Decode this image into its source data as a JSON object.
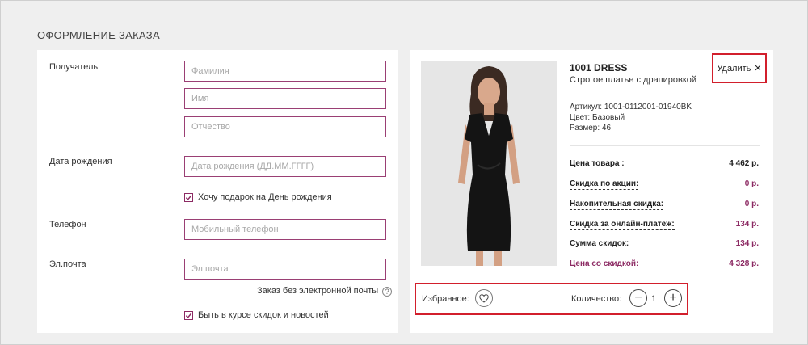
{
  "page": {
    "title": "ОФОРМЛЕНИЕ ЗАКАЗА"
  },
  "form": {
    "recipient_label": "Получатель",
    "last_name_placeholder": "Фамилия",
    "first_name_placeholder": "Имя",
    "middle_name_placeholder": "Отчество",
    "birthdate_label": "Дата рождения",
    "birthdate_placeholder": "Дата рождения (ДД.ММ.ГГГГ)",
    "birthday_gift_label": "Хочу подарок на День рождения",
    "birthday_gift_checked": true,
    "phone_label": "Телефон",
    "phone_placeholder": "Мобильный телефон",
    "email_label": "Эл.почта",
    "email_placeholder": "Эл.почта",
    "no_email_link": "Заказ без электронной почты",
    "help_glyph": "?",
    "newsletter_label": "Быть в курсе скидок и новостей",
    "newsletter_checked": true
  },
  "product": {
    "name": "1001 DRESS",
    "description": "Строгое платье с драпировкой",
    "remove_label": "Удалить",
    "remove_glyph": "✕",
    "article": "Артикул: 1001-0112001-01940BK",
    "color": "Цвет: Базовый",
    "size": "Размер: 46",
    "prices": [
      {
        "label": "Цена товара :",
        "value": "4 462 р."
      },
      {
        "label": "Скидка по акции:",
        "value": "0 р."
      },
      {
        "label": "Накопительная скидка:",
        "value": "0 р."
      },
      {
        "label": "Скидка за онлайн-платёж:",
        "value": "134 р."
      },
      {
        "label": "Сумма скидок:",
        "value": "134 р."
      },
      {
        "label": "Цена со скидкой:",
        "value": "4 328 р."
      }
    ],
    "favorite_label": "Избранное:",
    "quantity_label": "Количество:",
    "quantity": "1",
    "minus_glyph": "−",
    "plus_glyph": "+"
  },
  "colors": {
    "accent": "#8c2a63",
    "input_border": "#9a3f74",
    "highlight": "#d21f2c",
    "background": "#efefef"
  }
}
